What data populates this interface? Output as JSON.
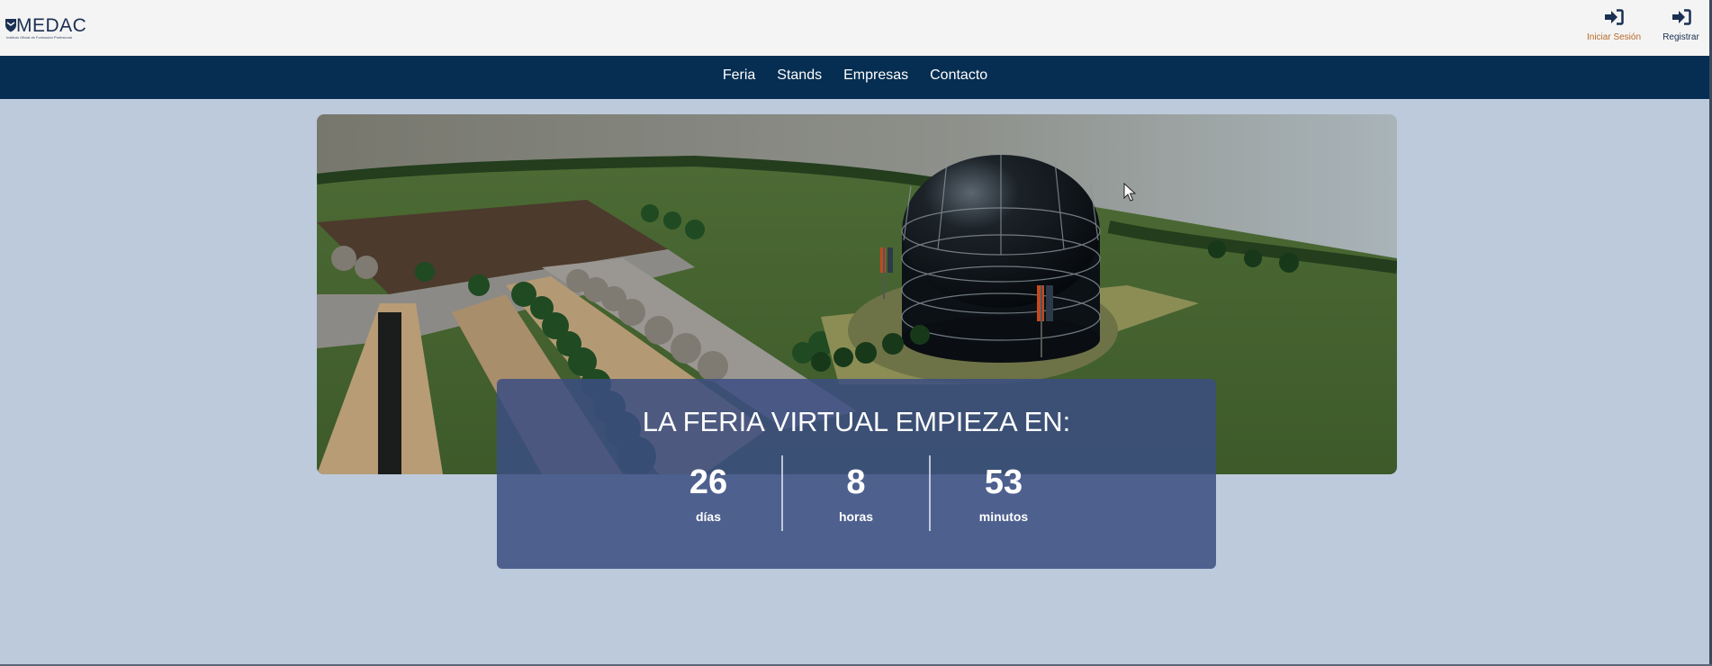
{
  "brand": {
    "name": "MEDAC",
    "tagline": "Instituto Oficial de Formación Profesional",
    "color": "#1b2f52"
  },
  "auth": {
    "login_label": "Iniciar Sesión",
    "register_label": "Registrar",
    "login_icon": "sign-in-icon",
    "register_icon": "sign-in-icon"
  },
  "nav": {
    "items": [
      {
        "label": "Feria"
      },
      {
        "label": "Stands"
      },
      {
        "label": "Empresas"
      },
      {
        "label": "Contacto"
      }
    ],
    "background": "#052e52"
  },
  "hero": {
    "image": "3d-virtual-fair-park-with-dome-building"
  },
  "countdown": {
    "title": "LA FERIA VIRTUAL EMPIEZA EN:",
    "days": {
      "value": "26",
      "label": "días"
    },
    "hours": {
      "value": "8",
      "label": "horas"
    },
    "minutes": {
      "value": "53",
      "label": "minutos"
    }
  },
  "colors": {
    "page_bg": "#bdcadb",
    "header_bg": "#f4f4f4",
    "countdown_bg": "#3b4e81",
    "login_label": "#b96a2a"
  }
}
